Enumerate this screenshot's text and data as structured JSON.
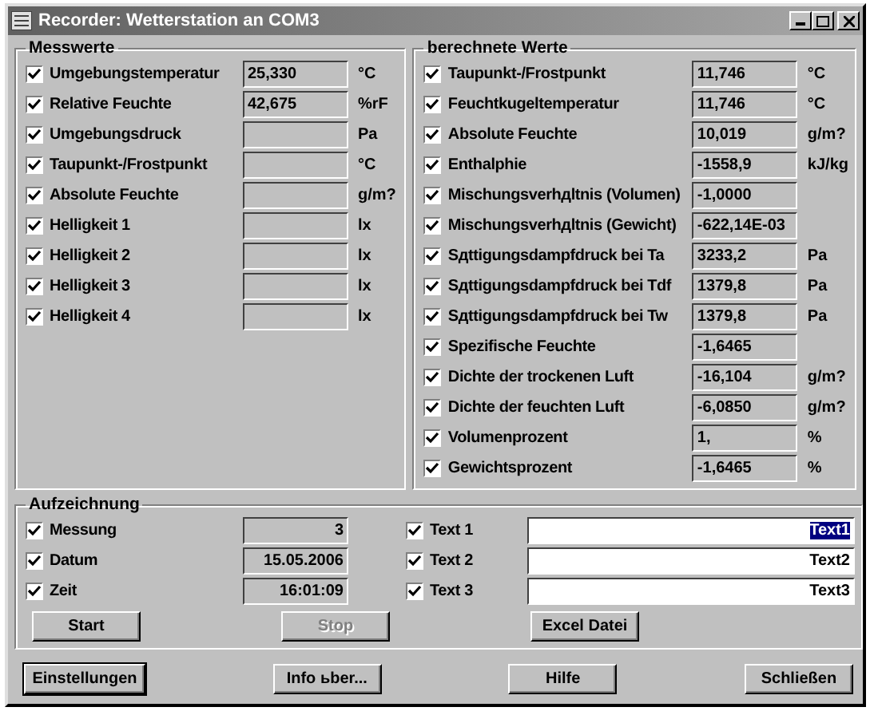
{
  "window": {
    "title": "Recorder: Wetterstation an COM3"
  },
  "measured": {
    "title": "Messwerte",
    "rows": [
      {
        "label": "Umgebungstemperatur",
        "checked": true,
        "value": "25,330",
        "unit": "°C"
      },
      {
        "label": "Relative Feuchte",
        "checked": true,
        "value": "42,675",
        "unit": "%rF"
      },
      {
        "label": "Umgebungsdruck",
        "checked": true,
        "value": "",
        "unit": "Pa"
      },
      {
        "label": "Taupunkt-/Frostpunkt",
        "checked": true,
        "value": "",
        "unit": "°C"
      },
      {
        "label": "Absolute Feuchte",
        "checked": true,
        "value": "",
        "unit": "g/m?"
      },
      {
        "label": "Helligkeit 1",
        "checked": true,
        "value": "",
        "unit": "lx"
      },
      {
        "label": "Helligkeit 2",
        "checked": true,
        "value": "",
        "unit": "lx"
      },
      {
        "label": "Helligkeit 3",
        "checked": true,
        "value": "",
        "unit": "lx"
      },
      {
        "label": "Helligkeit 4",
        "checked": true,
        "value": "",
        "unit": "lx"
      }
    ]
  },
  "calculated": {
    "title": "berechnete Werte",
    "rows": [
      {
        "label": "Taupunkt-/Frostpunkt",
        "checked": true,
        "value": "11,746",
        "unit": "°C"
      },
      {
        "label": "Feuchtkugeltemperatur",
        "checked": true,
        "value": "11,746",
        "unit": "°C"
      },
      {
        "label": "Absolute Feuchte",
        "checked": true,
        "value": "10,019",
        "unit": "g/m?"
      },
      {
        "label": "Enthalphie",
        "checked": true,
        "value": "-1558,9",
        "unit": "kJ/kg"
      },
      {
        "label": "Mischungsverhдltnis (Volumen)",
        "checked": true,
        "value": "-1,0000",
        "unit": ""
      },
      {
        "label": "Mischungsverhдltnis (Gewicht)",
        "checked": true,
        "value": "-622,14E-03",
        "unit": ""
      },
      {
        "label": "Sдttigungsdampfdruck bei Ta",
        "checked": true,
        "value": "3233,2",
        "unit": "Pa"
      },
      {
        "label": "Sдttigungsdampfdruck bei Tdf",
        "checked": true,
        "value": "1379,8",
        "unit": "Pa"
      },
      {
        "label": "Sдttigungsdampfdruck bei Tw",
        "checked": true,
        "value": "1379,8",
        "unit": "Pa"
      },
      {
        "label": "Spezifische Feuchte",
        "checked": true,
        "value": "-1,6465",
        "unit": ""
      },
      {
        "label": "Dichte der trockenen Luft",
        "checked": true,
        "value": "-16,104",
        "unit": "g/m?"
      },
      {
        "label": "Dichte der feuchten Luft",
        "checked": true,
        "value": "-6,0850",
        "unit": "g/m?"
      },
      {
        "label": "Volumenprozent",
        "checked": true,
        "value": "1,",
        "unit": "%"
      },
      {
        "label": "Gewichtsprozent",
        "checked": true,
        "value": "-1,6465",
        "unit": "%"
      }
    ]
  },
  "recording": {
    "title": "Aufzeichnung",
    "rows": [
      {
        "label": "Messung",
        "checked": true,
        "value": "3"
      },
      {
        "label": "Datum",
        "checked": true,
        "value": "15.05.2006"
      },
      {
        "label": "Zeit",
        "checked": true,
        "value": "16:01:09"
      }
    ],
    "texts": [
      {
        "label": "Text 1",
        "checked": true,
        "value": "Text1",
        "selected": true
      },
      {
        "label": "Text 2",
        "checked": true,
        "value": "Text2",
        "selected": false
      },
      {
        "label": "Text 3",
        "checked": true,
        "value": "Text3",
        "selected": false
      }
    ],
    "buttons": [
      {
        "label": "Start",
        "disabled": false
      },
      {
        "label": "Stop",
        "disabled": true
      },
      {
        "label": "Excel Datei",
        "disabled": false
      }
    ]
  },
  "buttons": [
    {
      "label": "Einstellungen",
      "default": true
    },
    {
      "label": "Info ьber...",
      "default": false
    },
    {
      "label": "Hilfe",
      "default": false
    },
    {
      "label": "Schließen",
      "default": false
    }
  ]
}
